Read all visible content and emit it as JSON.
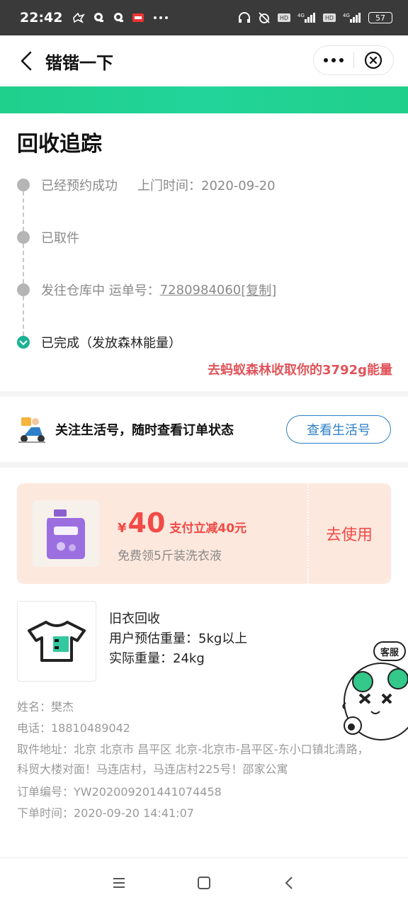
{
  "status_bar": {
    "time": "22:42",
    "battery": "57",
    "icons": [
      "chat-icon",
      "qq-icon",
      "qq-icon",
      "app-icon",
      "more-dots-icon",
      "headphone-icon",
      "alarm-off-icon",
      "hd-icon",
      "signal-4g-icon",
      "hd-icon",
      "signal-4g-icon",
      "battery-icon"
    ]
  },
  "nav": {
    "title": "锴锴一下"
  },
  "tracking": {
    "title": "回收追踪",
    "steps": [
      {
        "label": "已经预约成功",
        "extra": "上门时间：2020-09-20"
      },
      {
        "label": "已取件"
      },
      {
        "label": "发往仓库中 运单号：",
        "waybill": "7280984060",
        "copy": "[复制]"
      },
      {
        "label": "已完成（发放森林能量）"
      }
    ],
    "energy_link": "去蚂蚁森林收取你的3792g能量"
  },
  "follow": {
    "text": "关注生活号，随时查看订单状态",
    "button": "查看生活号"
  },
  "coupon": {
    "currency": "¥",
    "amount": "40",
    "desc": "支付立减40元",
    "sub": "免费领5斤装洗衣液",
    "use": "去使用",
    "colors": {
      "bg": "#fde8de",
      "accent": "#f24a46"
    }
  },
  "item": {
    "name": "旧衣回收",
    "estimate": "用户预估重量：5kg以上",
    "actual": "实际重量：24kg"
  },
  "order": {
    "name": "姓名：樊杰",
    "phone": "电话：18810489042",
    "address": "取件地址：北京 北京市 昌平区 北京-北京市-昌平区-东小口镇北清路，科贸大楼对面！马连店村，马连店村225号！邵家公寓",
    "order_no": "订单编号：YW202009201441074458",
    "order_time": "下单时间：2020-09-20 14:41:07"
  },
  "mascot": {
    "badge": "客服"
  },
  "colors": {
    "green": "#22d49a",
    "link_red": "#e0545a",
    "button_blue": "#2d7fc8"
  }
}
